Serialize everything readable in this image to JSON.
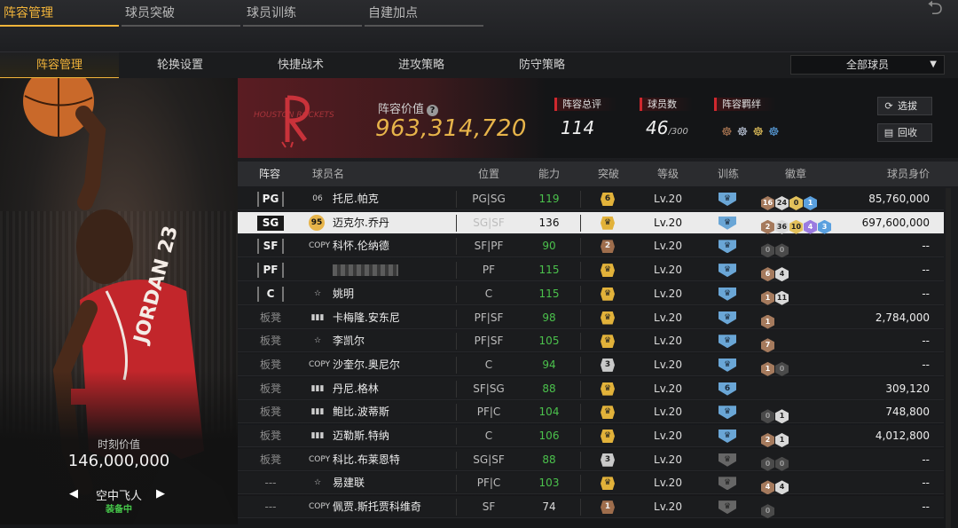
{
  "top_tabs": [
    "阵容管理",
    "球员突破",
    "球员训练",
    "自建加点"
  ],
  "sub_tabs": [
    "阵容管理",
    "轮换设置",
    "快捷战术",
    "进攻策略",
    "防守策略"
  ],
  "filter": {
    "value": "全部球员"
  },
  "left_panel": {
    "moment_label": "时刻价值",
    "moment_value": "146,000,000",
    "card_name": "空中飞人",
    "equipped": "装备中",
    "arrow_left": "◀",
    "arrow_right": "▶",
    "jersey_text": "JORDAN 23"
  },
  "team": {
    "logo_text": "HOUSTON ROCKETS",
    "value_label": "阵容价值",
    "value": "963,314,720",
    "rating_label": "阵容总评",
    "rating": "114",
    "roster_label": "球员数",
    "roster_count": "46",
    "roster_max": "/300",
    "bond_label": "阵容羁绊",
    "filter_button": "选拔",
    "recycle_button": "回收"
  },
  "table": {
    "headers": [
      "阵容",
      "球员名",
      "位置",
      "能力",
      "突破",
      "等级",
      "训练",
      "徽章",
      "球员身价"
    ],
    "rows": [
      {
        "slot": "PG",
        "icon": "06",
        "name": "托尼.帕克",
        "pos": "PG|SG",
        "ability": "119",
        "brk": "6",
        "brk_color": "gold",
        "level": "Lv.20",
        "train": "",
        "train_color": "blue",
        "badges": [
          {
            "v": "16",
            "c": "bronze"
          },
          {
            "v": "24",
            "c": "silver"
          },
          {
            "v": "0",
            "c": "gold"
          },
          {
            "v": "1",
            "c": "blue"
          }
        ],
        "price": "85,760,000"
      },
      {
        "slot": "SG",
        "icon": "95",
        "name": "迈克尔.乔丹",
        "pos": "SG|SF",
        "ability": "136",
        "brk": "",
        "brk_color": "gold",
        "level": "Lv.20",
        "train": "",
        "train_color": "blue",
        "badges": [
          {
            "v": "2",
            "c": "bronze"
          },
          {
            "v": "36",
            "c": "silver"
          },
          {
            "v": "10",
            "c": "gold"
          },
          {
            "v": "4",
            "c": "purple"
          },
          {
            "v": "3",
            "c": "blue"
          }
        ],
        "price": "697,600,000"
      },
      {
        "slot": "SF",
        "icon": "COPY",
        "name": "科怀.伦纳德",
        "pos": "SF|PF",
        "ability": "90",
        "brk": "2",
        "brk_color": "bronze",
        "level": "Lv.20",
        "train": "",
        "train_color": "blue",
        "badges": [
          {
            "v": "0",
            "c": "dark"
          },
          {
            "v": "0",
            "c": "dark"
          }
        ],
        "price": "--"
      },
      {
        "slot": "PF",
        "icon": "",
        "name": "",
        "pos": "PF",
        "ability": "115",
        "brk": "",
        "brk_color": "gold",
        "level": "Lv.20",
        "train": "",
        "train_color": "blue",
        "badges": [
          {
            "v": "6",
            "c": "bronze"
          },
          {
            "v": "4",
            "c": "silver"
          }
        ],
        "price": "--"
      },
      {
        "slot": "C",
        "icon": "☆",
        "name": "姚明",
        "pos": "C",
        "ability": "115",
        "brk": "",
        "brk_color": "gold",
        "level": "Lv.20",
        "train": "",
        "train_color": "blue",
        "badges": [
          {
            "v": "1",
            "c": "bronze"
          },
          {
            "v": "11",
            "c": "silver"
          }
        ],
        "price": "--"
      },
      {
        "slot": "板凳",
        "icon": "▮▮▮",
        "name": "卡梅隆.安东尼",
        "pos": "PF|SF",
        "ability": "98",
        "brk": "",
        "brk_color": "gold",
        "level": "Lv.20",
        "train": "",
        "train_color": "blue",
        "badges": [
          {
            "v": "1",
            "c": "bronze"
          }
        ],
        "price": "2,784,000"
      },
      {
        "slot": "板凳",
        "icon": "☆",
        "name": "李凯尔",
        "pos": "PF|SF",
        "ability": "105",
        "brk": "",
        "brk_color": "gold",
        "level": "Lv.20",
        "train": "",
        "train_color": "blue",
        "badges": [
          {
            "v": "7",
            "c": "bronze"
          }
        ],
        "price": "--"
      },
      {
        "slot": "板凳",
        "icon": "COPY",
        "name": "沙奎尔.奥尼尔",
        "pos": "C",
        "ability": "94",
        "brk": "3",
        "brk_color": "silver",
        "level": "Lv.20",
        "train": "",
        "train_color": "blue",
        "badges": [
          {
            "v": "1",
            "c": "bronze"
          },
          {
            "v": "0",
            "c": "dark"
          }
        ],
        "price": "--"
      },
      {
        "slot": "板凳",
        "icon": "▮▮▮",
        "name": "丹尼.格林",
        "pos": "SF|SG",
        "ability": "88",
        "brk": "",
        "brk_color": "gold",
        "level": "Lv.20",
        "train": "6",
        "train_color": "blue",
        "badges": [],
        "price": "309,120"
      },
      {
        "slot": "板凳",
        "icon": "▮▮▮",
        "name": "鲍比.波蒂斯",
        "pos": "PF|C",
        "ability": "104",
        "brk": "",
        "brk_color": "gold",
        "level": "Lv.20",
        "train": "",
        "train_color": "blue",
        "badges": [
          {
            "v": "0",
            "c": "dark"
          },
          {
            "v": "1",
            "c": "silver"
          }
        ],
        "price": "748,800"
      },
      {
        "slot": "板凳",
        "icon": "▮▮▮",
        "name": "迈勒斯.特纳",
        "pos": "C",
        "ability": "106",
        "brk": "",
        "brk_color": "gold",
        "level": "Lv.20",
        "train": "",
        "train_color": "blue",
        "badges": [
          {
            "v": "2",
            "c": "bronze"
          },
          {
            "v": "1",
            "c": "silver"
          }
        ],
        "price": "4,012,800"
      },
      {
        "slot": "板凳",
        "icon": "COPY",
        "name": "科比.布莱恩特",
        "pos": "SG|SF",
        "ability": "88",
        "brk": "3",
        "brk_color": "silver",
        "level": "Lv.20",
        "train": "",
        "train_color": "grey",
        "badges": [
          {
            "v": "0",
            "c": "dark"
          },
          {
            "v": "0",
            "c": "dark"
          }
        ],
        "price": "--"
      },
      {
        "slot": "---",
        "icon": "☆",
        "name": "易建联",
        "pos": "PF|C",
        "ability": "103",
        "brk": "",
        "brk_color": "gold",
        "level": "Lv.20",
        "train": "",
        "train_color": "grey",
        "badges": [
          {
            "v": "4",
            "c": "bronze"
          },
          {
            "v": "4",
            "c": "silver"
          }
        ],
        "price": "--"
      },
      {
        "slot": "---",
        "icon": "COPY",
        "name": "佩贾.斯托贾科维奇",
        "pos": "SF",
        "ability": "74",
        "brk": "1",
        "brk_color": "bronze",
        "level": "Lv.20",
        "train": "",
        "train_color": "grey",
        "badges": [
          {
            "v": "0",
            "c": "dark"
          }
        ],
        "price": "--"
      }
    ]
  }
}
